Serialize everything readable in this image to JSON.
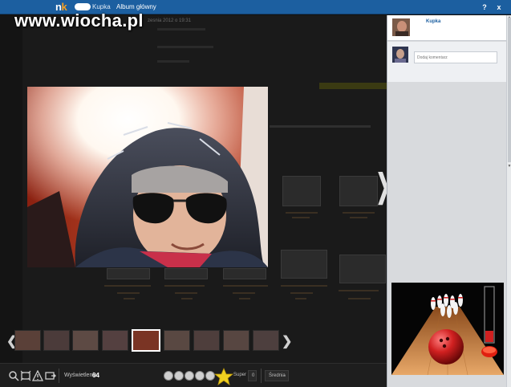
{
  "topbar": {
    "logo_n": "n",
    "logo_k": "k",
    "username": "Kupka",
    "album_link": "Album główny",
    "help_label": "?",
    "close_label": "x"
  },
  "watermark": "www.wiocha.pl",
  "background": {
    "date_text": "zesnia 2012 o 19:31"
  },
  "nav": {
    "next_arrow": "❯",
    "film_prev": "❮",
    "film_next": "❯"
  },
  "stats": {
    "views_label": "Wyświetlenia:",
    "views_count": "64"
  },
  "rating": {
    "star_label": "Super",
    "dropdown": "0",
    "average_label": "Średnia",
    "average_value": "-"
  },
  "sidebar": {
    "owner_name": "Kupka",
    "comment_placeholder": "Dodaj komentarz"
  },
  "colors": {
    "topbar": "#1c5fa0",
    "logo_accent": "#f8a020",
    "sidebar_bg": "#d8dadd",
    "stage_bg": "#141414"
  },
  "icons": {
    "zoom": "magnifier-icon",
    "fit": "fit-screen-icon",
    "report": "warning-icon",
    "share": "share-icon"
  }
}
